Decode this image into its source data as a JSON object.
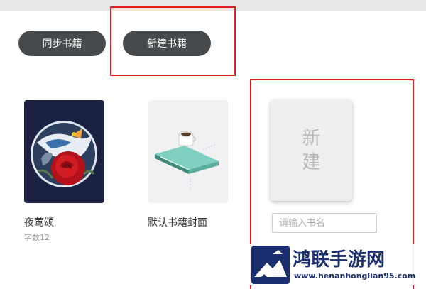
{
  "toolbar": {
    "sync_label": "同步书籍",
    "new_label": "新建书籍"
  },
  "books": [
    {
      "title": "夜莺颂",
      "word_count": "字数12"
    },
    {
      "title": "默认书籍封面"
    }
  ],
  "new_book": {
    "cover_text_line1": "新",
    "cover_text_line2": "建",
    "input_placeholder": "请输入书名"
  },
  "watermark": {
    "title": "鸿联手游网",
    "url": "www.henanhonglian95.com"
  },
  "colors": {
    "button_bg": "#474a4c",
    "highlight": "#e02020",
    "watermark": "#1b2f6e"
  }
}
